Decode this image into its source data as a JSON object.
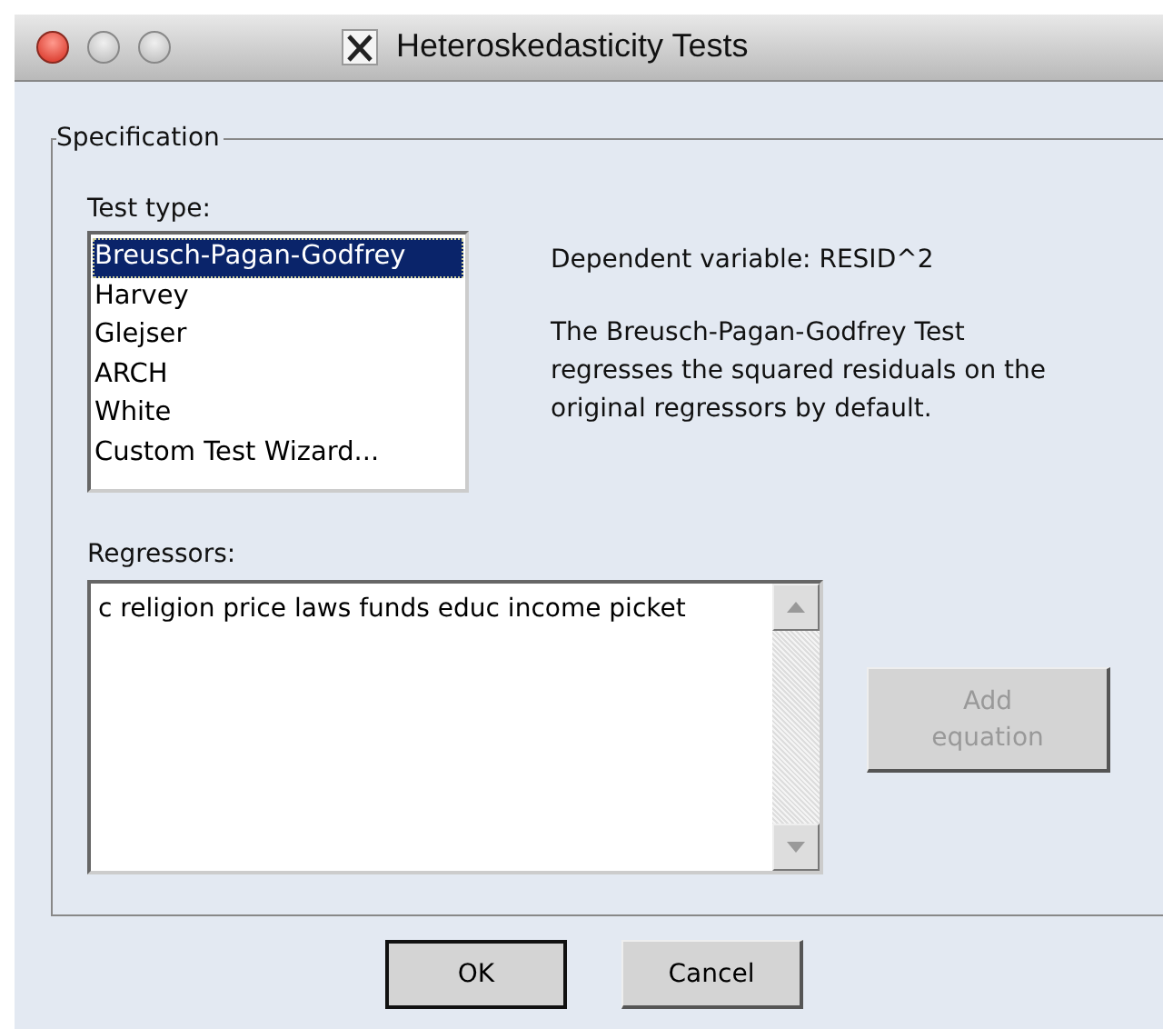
{
  "window": {
    "title": "Heteroskedasticity Tests"
  },
  "specification": {
    "legend": "Specification",
    "test_type": {
      "label": "Test type:",
      "items": [
        {
          "label": "Breusch-Pagan-Godfrey",
          "selected": true
        },
        {
          "label": "Harvey",
          "selected": false
        },
        {
          "label": "Glejser",
          "selected": false
        },
        {
          "label": "ARCH",
          "selected": false
        },
        {
          "label": "White",
          "selected": false
        },
        {
          "label": "Custom Test Wizard...",
          "selected": false
        }
      ]
    },
    "dependent_variable": "Dependent variable: RESID^2",
    "description": "The Breusch-Pagan-Godfrey Test regresses the squared residuals on the original regressors by default.",
    "regressors": {
      "label": "Regressors:",
      "value": "c religion price laws funds educ income picket"
    },
    "add_equation": {
      "label": "Add equation",
      "disabled": true
    }
  },
  "buttons": [
    {
      "label": "OK",
      "default": true
    },
    {
      "label": "Cancel",
      "default": false
    }
  ]
}
